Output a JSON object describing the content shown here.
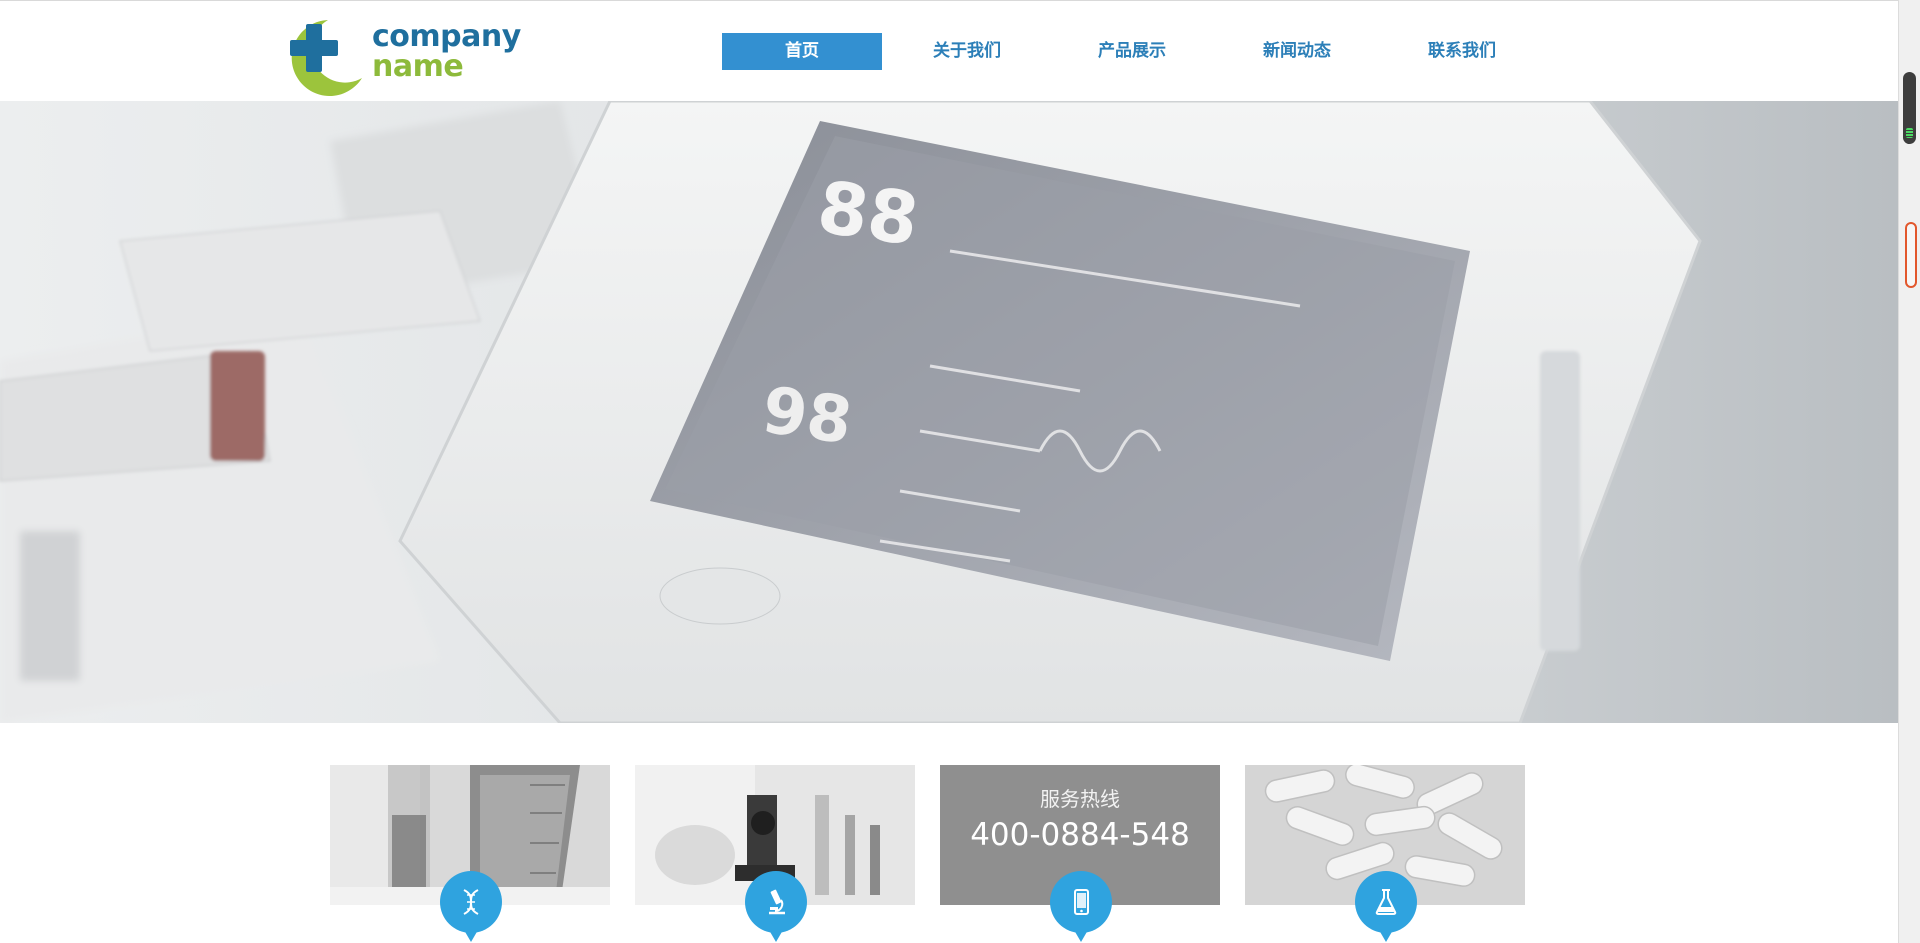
{
  "brand": {
    "line1": "company",
    "line2": "name",
    "colors": {
      "blue": "#1f6f9e",
      "green": "#8dba3b"
    }
  },
  "nav": {
    "items": [
      {
        "label": "首页",
        "active": true
      },
      {
        "label": "关于我们",
        "active": false
      },
      {
        "label": "产品展示",
        "active": false
      },
      {
        "label": "新闻动态",
        "active": false
      },
      {
        "label": "联系我们",
        "active": false
      }
    ],
    "active_color": "#3390d1"
  },
  "banner": {
    "screen_readouts": [
      "88",
      "98"
    ],
    "slides": 2,
    "active_slide": 1
  },
  "features": {
    "cards": [
      {
        "icon": "dna-icon"
      },
      {
        "icon": "microscope-icon"
      },
      {
        "icon": "mobile-phone-icon",
        "title": "服务热线",
        "number": "400-0884-548"
      },
      {
        "icon": "flask-icon"
      }
    ],
    "badge_color": "#2fa3df"
  }
}
